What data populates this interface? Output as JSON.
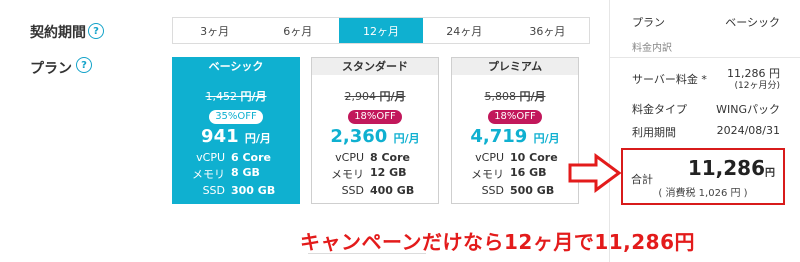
{
  "labels": {
    "contract_period": "契約期間",
    "plan": "プラン",
    "help": "?"
  },
  "term_tabs": [
    "3ヶ月",
    "6ヶ月",
    "12ヶ月",
    "24ヶ月",
    "36ヶ月"
  ],
  "selected_term": "12ヶ月",
  "spec_keys": {
    "cpu": "vCPU",
    "memory": "メモリ",
    "ssd": "SSD"
  },
  "plans": [
    {
      "name": "ベーシック",
      "old_price": "1,452",
      "old_unit": "円/月",
      "discount": "35%OFF",
      "price": "941",
      "price_unit": "円/月",
      "cpu": "6 Core",
      "memory": "8 GB",
      "ssd": "300 GB",
      "selected": true
    },
    {
      "name": "スタンダード",
      "old_price": "2,904",
      "old_unit": "円/月",
      "discount": "18%OFF",
      "price": "2,360",
      "price_unit": "円/月",
      "cpu": "8 Core",
      "memory": "12 GB",
      "ssd": "400 GB",
      "selected": false
    },
    {
      "name": "プレミアム",
      "old_price": "5,808",
      "old_unit": "円/月",
      "discount": "18%OFF",
      "price": "4,719",
      "price_unit": "円/月",
      "cpu": "10 Core",
      "memory": "16 GB",
      "ssd": "500 GB",
      "selected": false
    }
  ],
  "summary": {
    "plan_label": "プラン",
    "plan_value": "ベーシック",
    "breakdown_label": "料金内訳",
    "server_fee_label": "サーバー料金 *",
    "server_fee_value": "11,286 円",
    "server_fee_note": "(12ヶ月分)",
    "fee_type_label": "料金タイプ",
    "fee_type_value": "WINGパック",
    "period_label": "利用期間",
    "period_value": "2024/08/31",
    "total_label": "合計",
    "total_amount": "11,286",
    "total_unit": "円",
    "tax_note": "( 消費税 1,026 円 )"
  },
  "caption": "キャンペーンだけなら12ヶ月で11,286円",
  "colors": {
    "accent": "#0fb0d0",
    "discount_badge": "#c2185b",
    "highlight_red": "#e31b1b"
  }
}
